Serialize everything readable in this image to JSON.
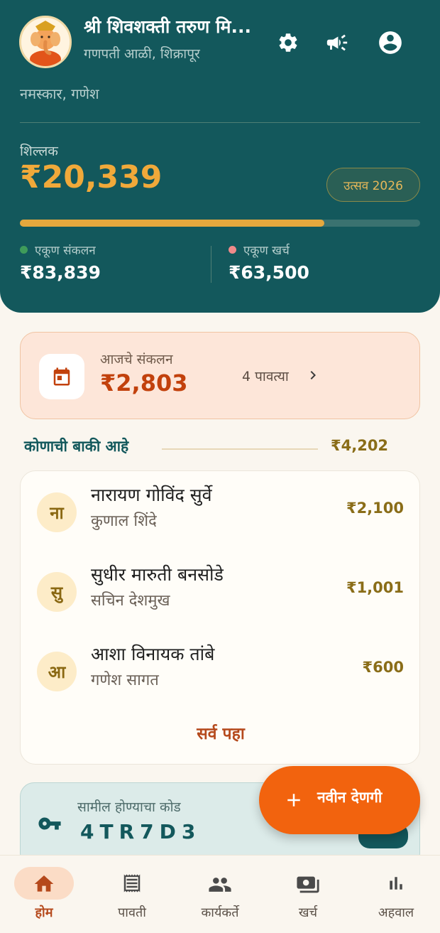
{
  "header": {
    "org_name": "श्री शिवशक्ती तरुण मि...",
    "location": "गणपती आळी, शिक्रापूर",
    "greeting": "नमस्कार, गणेश",
    "balance_label": "शिल्लक",
    "balance_amount": "₹20,339",
    "festival_chip": "उत्सव 2026",
    "progress_fraction": 0.76,
    "total_collection_label": "एकूण संकलन",
    "total_collection_value": "₹83,839",
    "total_expense_label": "एकूण खर्च",
    "total_expense_value": "₹63,500",
    "icons": [
      "settings-icon",
      "megaphone-icon",
      "account-icon"
    ]
  },
  "today": {
    "label": "आजचे संकलन",
    "amount": "₹2,803",
    "count": "4 पावत्या"
  },
  "pending": {
    "title": "कोणाची बाकी आहे",
    "total": "₹4,202",
    "items": [
      {
        "initial": "ना",
        "name": "नारायण गोविंद सुर्वे",
        "collector": "कुणाल शिंदे",
        "amount": "₹2,100"
      },
      {
        "initial": "सु",
        "name": "सुधीर मारुती बनसोडे",
        "collector": "सचिन देशमुख",
        "amount": "₹1,001"
      },
      {
        "initial": "आ",
        "name": "आशा विनायक तांबे",
        "collector": "गणेश सागत",
        "amount": "₹600"
      }
    ],
    "see_all": "सर्व पहा"
  },
  "join": {
    "label": "सामील होण्याचा कोड",
    "code": "4TR7D3"
  },
  "fab": {
    "label": "नवीन देणगी"
  },
  "nav": {
    "items": [
      {
        "label": "होम",
        "icon": "home-icon",
        "active": true
      },
      {
        "label": "पावती",
        "icon": "receipt-icon",
        "active": false
      },
      {
        "label": "कार्यकर्ते",
        "icon": "people-icon",
        "active": false
      },
      {
        "label": "खर्च",
        "icon": "payments-icon",
        "active": false
      },
      {
        "label": "अहवाल",
        "icon": "bar-chart-icon",
        "active": false
      }
    ]
  },
  "colors": {
    "header_bg": "#13585c",
    "accent_gold": "#f0a93a",
    "accent_orange": "#f2630e",
    "collection_dot": "#3f9b5a",
    "expense_dot": "#f08a8a"
  }
}
